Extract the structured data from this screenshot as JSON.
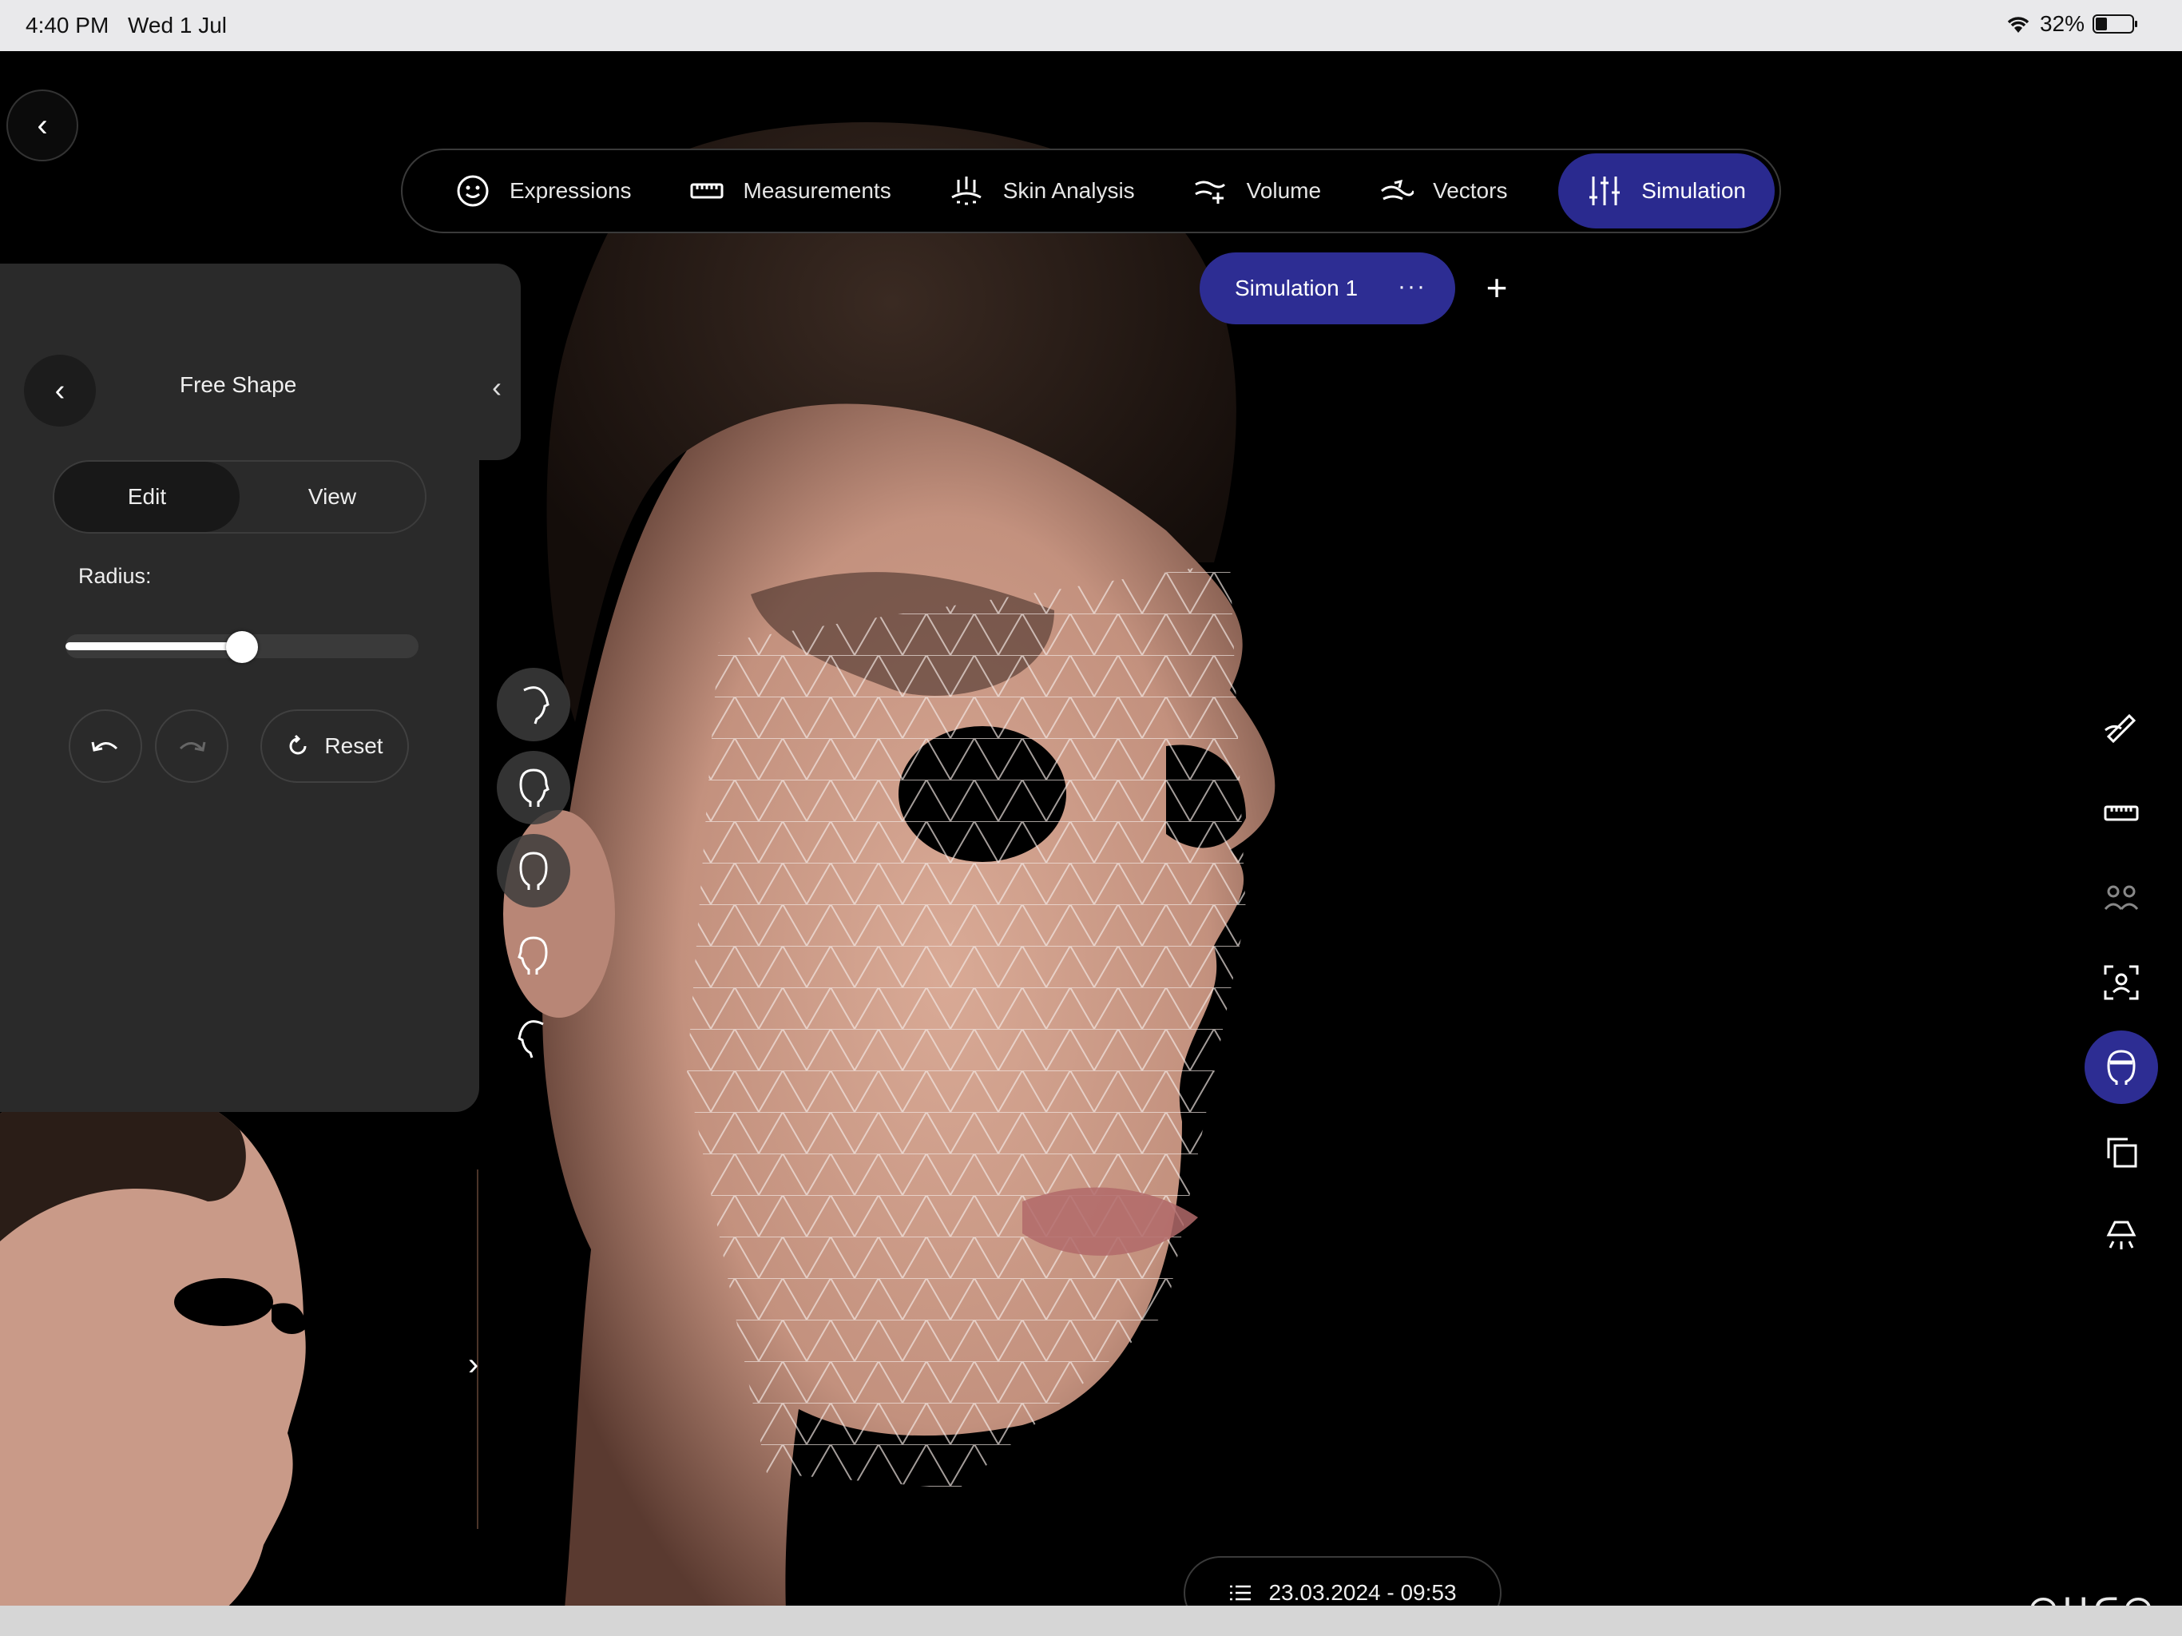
{
  "status_bar": {
    "time": "4:40 PM",
    "date": "Wed 1 Jul",
    "battery": "32%",
    "battery_level": 0.32,
    "wifi_icon": "wifi-icon"
  },
  "nav": {
    "tabs": [
      {
        "label": "Expressions",
        "icon": "smiley-icon"
      },
      {
        "label": "Measurements",
        "icon": "ruler-icon"
      },
      {
        "label": "Skin Analysis",
        "icon": "skin-analysis-icon"
      },
      {
        "label": "Volume",
        "icon": "volume-icon"
      },
      {
        "label": "Vectors",
        "icon": "vectors-icon"
      },
      {
        "label": "Simulation",
        "icon": "sliders-icon",
        "active": true
      }
    ]
  },
  "simulation": {
    "label": "Simulation 1",
    "more": "···",
    "add": "+"
  },
  "panel": {
    "title": "Free Shape",
    "segments": [
      "Edit",
      "View"
    ],
    "selected_segment": "Edit",
    "radius_label": "Radius:",
    "radius_value": 0.5,
    "reset_label": "Reset"
  },
  "session": {
    "date": "23.03.2024 - 09:53"
  },
  "brand": {
    "logo": "ᗩᑌᑕᗩ"
  },
  "colors": {
    "accent": "#2d2d93",
    "panel": "#2a2a2a",
    "background": "#000000"
  }
}
